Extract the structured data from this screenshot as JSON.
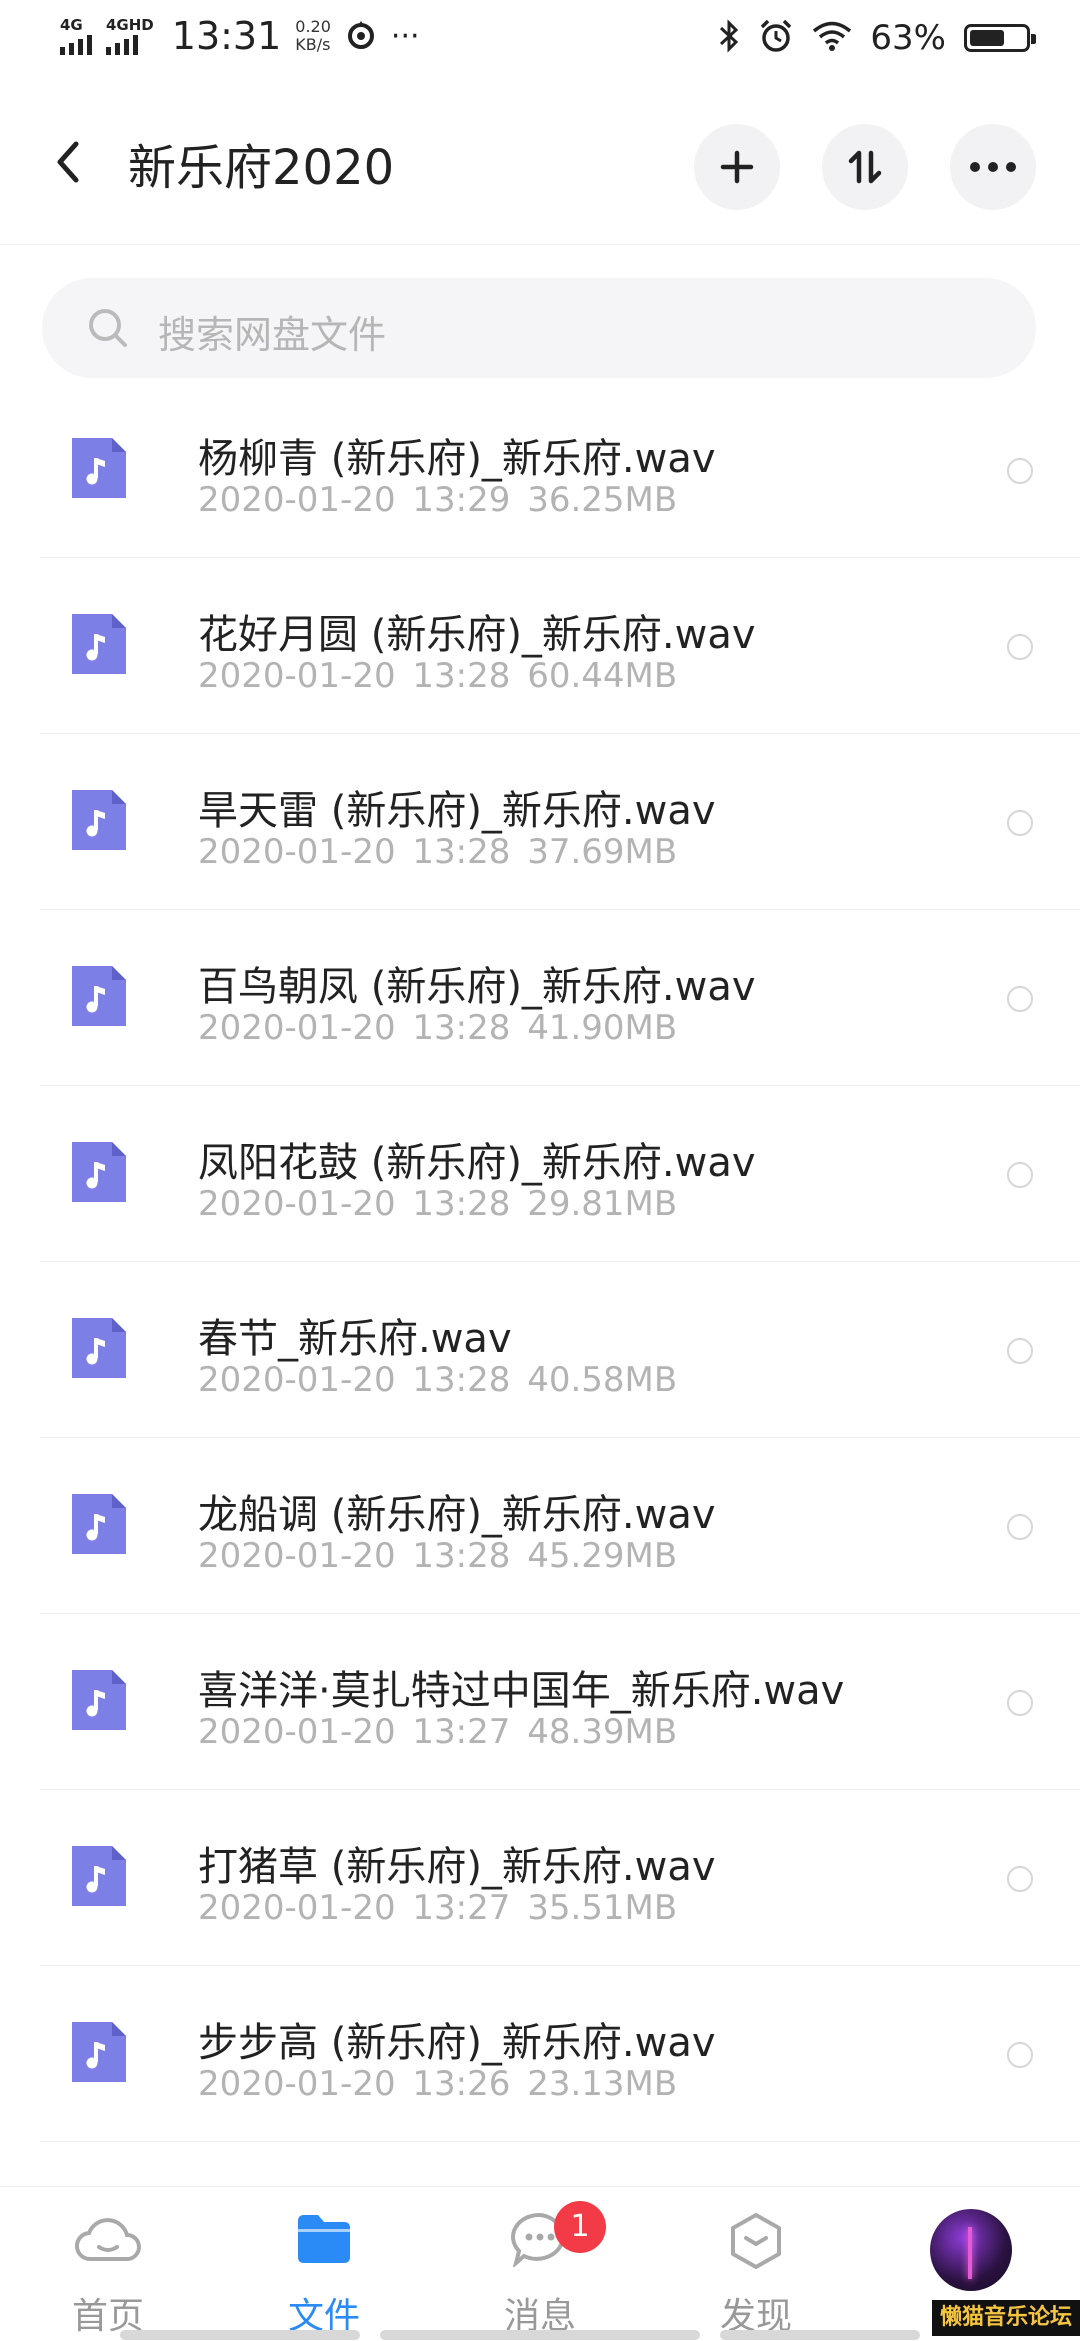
{
  "status_bar": {
    "sim1": "4G",
    "sim2": "4GHD",
    "time": "13:31",
    "speed_value": "0.20",
    "speed_unit": "KB/s",
    "more": "···",
    "battery_percent": "63%",
    "battery_level": 0.63
  },
  "header": {
    "title": "新乐府2020",
    "add_icon": "plus-icon",
    "sort_icon": "sort-icon",
    "more_icon": "more-horizontal-icon"
  },
  "search": {
    "placeholder": "搜索网盘文件"
  },
  "files": [
    {
      "name": "杨柳青 (新乐府)_新乐府.wav",
      "date": "2020-01-20",
      "time": "13:29",
      "size": "36.25MB"
    },
    {
      "name": "花好月圆 (新乐府)_新乐府.wav",
      "date": "2020-01-20",
      "time": "13:28",
      "size": "60.44MB"
    },
    {
      "name": "旱天雷 (新乐府)_新乐府.wav",
      "date": "2020-01-20",
      "time": "13:28",
      "size": "37.69MB"
    },
    {
      "name": "百鸟朝凤 (新乐府)_新乐府.wav",
      "date": "2020-01-20",
      "time": "13:28",
      "size": "41.90MB"
    },
    {
      "name": "凤阳花鼓 (新乐府)_新乐府.wav",
      "date": "2020-01-20",
      "time": "13:28",
      "size": "29.81MB"
    },
    {
      "name": "春节_新乐府.wav",
      "date": "2020-01-20",
      "time": "13:28",
      "size": "40.58MB"
    },
    {
      "name": "龙船调 (新乐府)_新乐府.wav",
      "date": "2020-01-20",
      "time": "13:28",
      "size": "45.29MB"
    },
    {
      "name": "喜洋洋·莫扎特过中国年_新乐府.wav",
      "date": "2020-01-20",
      "time": "13:27",
      "size": "48.39MB"
    },
    {
      "name": "打猪草 (新乐府)_新乐府.wav",
      "date": "2020-01-20",
      "time": "13:27",
      "size": "35.51MB"
    },
    {
      "name": "步步高 (新乐府)_新乐府.wav",
      "date": "2020-01-20",
      "time": "13:26",
      "size": "23.13MB"
    }
  ],
  "file_icon": "music-file-icon",
  "bottom_nav": {
    "home": "首页",
    "files": "文件",
    "messages": "消息",
    "messages_badge": "1",
    "discover": "发现",
    "active": "files"
  },
  "watermark": "懒猫音乐论坛",
  "colors": {
    "accent": "#2a8af6",
    "file_icon": "#7b7fe6",
    "badge": "#f23b46"
  }
}
